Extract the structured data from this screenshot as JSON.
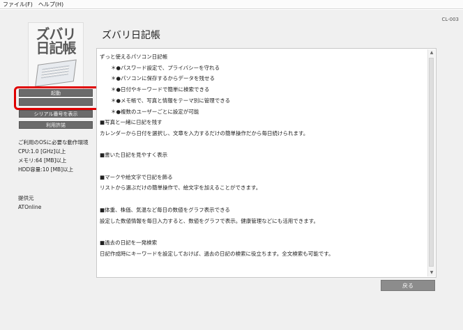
{
  "menu": [
    "ファイル(F)",
    "ヘルプ(H)"
  ],
  "window_code": "CL-003",
  "logo": {
    "line1": "ズバリ",
    "line2": "日記帳"
  },
  "sidebar": {
    "buttons": [
      "起動",
      "",
      "シリアル番号を表示",
      "利用許諾"
    ]
  },
  "system_requirements": {
    "heading": "ご利用のOSに必要な動作環境",
    "cpu": "CPU:1.0 [GHz]以上",
    "memory": "メモリ:64 [MB]以上",
    "hdd": "HDD容量:10 [MB]以上"
  },
  "provider": {
    "label": "提供元",
    "name": "ATOnline"
  },
  "app_title": "ズバリ日記帳",
  "description": [
    {
      "text": "ずっと使えるパソコン日記帳",
      "type": "text"
    },
    {
      "text": "＊●パスワード設定で、プライバシーを守れる",
      "type": "bullet"
    },
    {
      "text": "＊●パソコンに保存するからデータを残せる",
      "type": "bullet"
    },
    {
      "text": "＊●日付やキーワードで簡単に検索できる",
      "type": "bullet"
    },
    {
      "text": "＊●メモ帳で、写真と情報をテーマ別に管理できる",
      "type": "bullet"
    },
    {
      "text": "＊●複数のユーザーごとに設定が可能",
      "type": "bullet"
    },
    {
      "text": "■写真と一緒に日記を残す",
      "type": "text"
    },
    {
      "text": "カレンダーから日付を選択し、文章を入力するだけの簡単操作だから毎日続けられます。",
      "type": "text"
    },
    {
      "text": "",
      "type": "blank"
    },
    {
      "text": "■書いた日記を見やすく表示",
      "type": "text"
    },
    {
      "text": "",
      "type": "blank"
    },
    {
      "text": "■マークや絵文字で日記を飾る",
      "type": "text"
    },
    {
      "text": "リストから選ぶだけの簡単操作で、絵文字を加えることができます。",
      "type": "text"
    },
    {
      "text": "",
      "type": "blank"
    },
    {
      "text": "■体重、株価、気温など毎日の数値をグラフ表示できる",
      "type": "text"
    },
    {
      "text": "設定した数値情報を毎日入力すると、数値をグラフで表示。健康管理などにも活用できます。",
      "type": "text"
    },
    {
      "text": "",
      "type": "blank"
    },
    {
      "text": "■過去の日記を一発検索",
      "type": "text"
    },
    {
      "text": "日記作成時にキーワードを設定しておけば、過去の日記の検索に役立ちます。全文検索も可能です。",
      "type": "text"
    }
  ],
  "back_button": "戻る",
  "scroll": {
    "up_glyph": "▲",
    "down_glyph": "▼"
  }
}
